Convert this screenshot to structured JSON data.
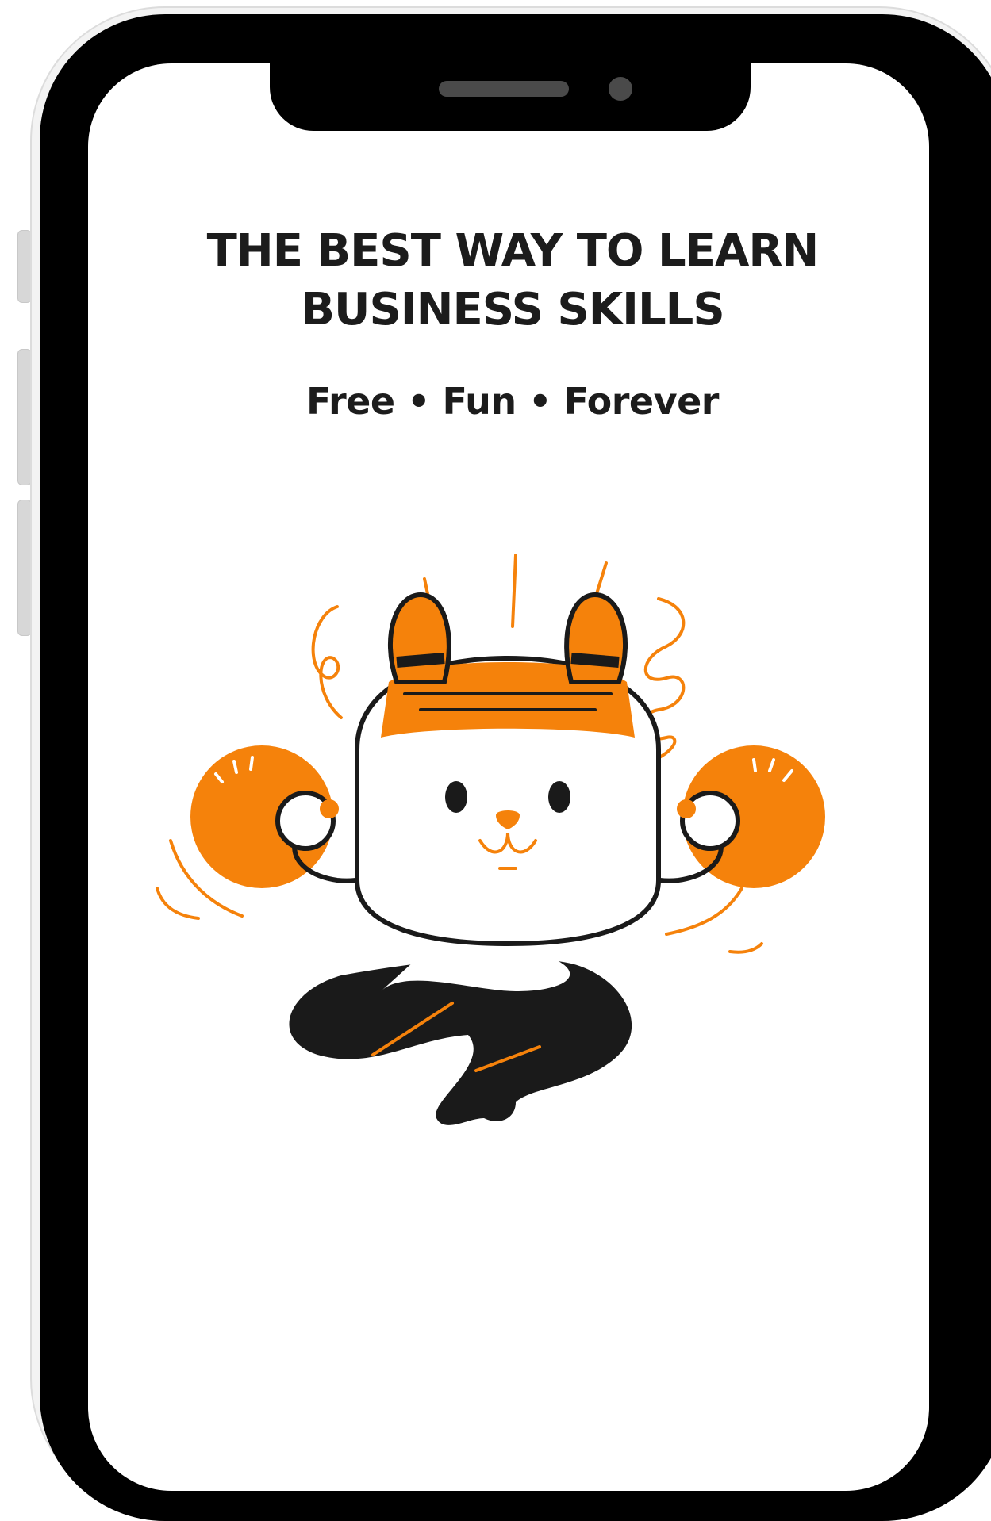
{
  "screen": {
    "headline_line1": "THE BEST WAY TO LEARN",
    "headline_line2": "BUSINESS SKILLS",
    "tagline": "Free • Fun • Forever"
  },
  "illustration": {
    "subject": "meditating-bunny-mascot",
    "accent_color": "#F5820B",
    "ink_color": "#1A1A1A"
  },
  "device": {
    "frame_color": "#000000",
    "bezel_color": "#F3F3F3"
  }
}
